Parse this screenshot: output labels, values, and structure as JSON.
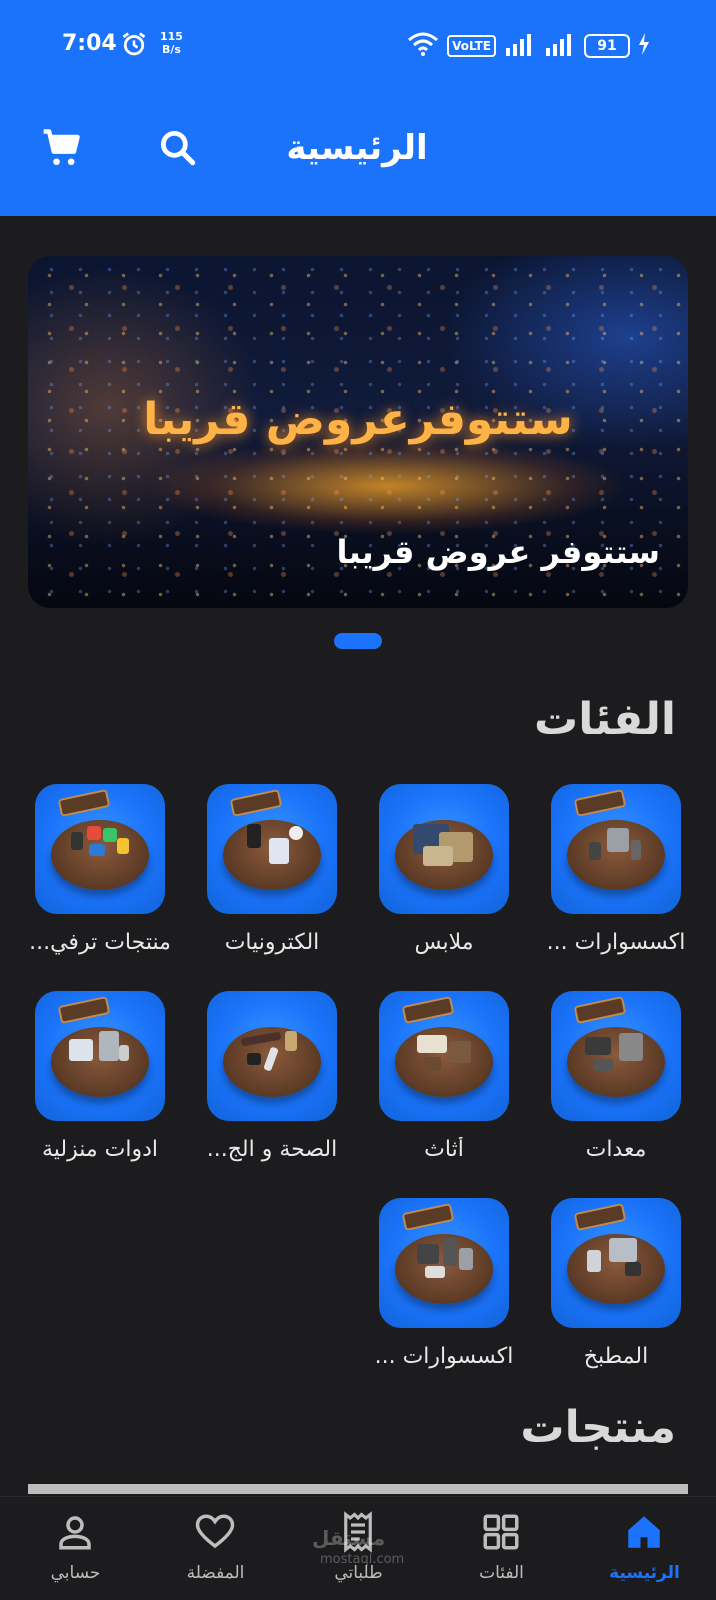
{
  "status_bar": {
    "time": "7:04",
    "net_speed_value": "115",
    "net_speed_unit": "B/s",
    "volte": "VoLTE",
    "battery": "91"
  },
  "header": {
    "title": "الرئيسية",
    "icons": [
      "search-icon",
      "cart-icon"
    ],
    "color": "#1a73fa"
  },
  "banner": {
    "headline": "ستتوفرعروض قريبا",
    "caption": "ستتوفر عروض قريبا"
  },
  "categories_section": {
    "title": "الفئات",
    "items": [
      {
        "label": "اكسسوارات ..."
      },
      {
        "label": "ملابس"
      },
      {
        "label": "الكترونيات"
      },
      {
        "label": "منتجات ترفي..."
      },
      {
        "label": "معدات"
      },
      {
        "label": "أثاث"
      },
      {
        "label": "الصحة و الج..."
      },
      {
        "label": "ادوات منزلية"
      },
      {
        "label": "المطبخ"
      },
      {
        "label": "اكسسوارات ..."
      }
    ]
  },
  "products_section": {
    "title": "منتجات"
  },
  "bottom_nav": {
    "items": [
      {
        "label": "الرئيسية",
        "icon": "home-icon",
        "active": true
      },
      {
        "label": "الفئات",
        "icon": "grid-icon"
      },
      {
        "label": "طلباتي",
        "icon": "receipt-icon"
      },
      {
        "label": "المفضلة",
        "icon": "heart-icon"
      },
      {
        "label": "حسابي",
        "icon": "person-icon"
      }
    ]
  },
  "watermark": {
    "text": "مستقل",
    "sub": "mostaql.com"
  }
}
